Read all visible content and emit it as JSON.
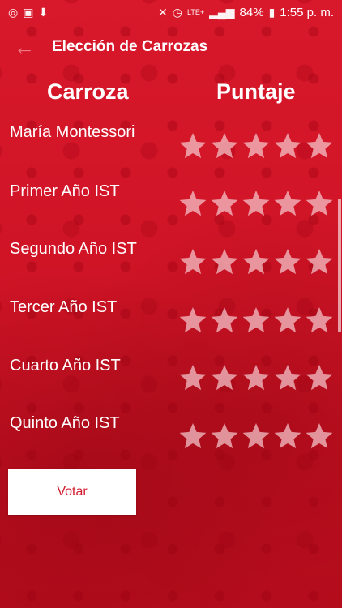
{
  "status_bar": {
    "battery": "84%",
    "time": "1:55 p. m.",
    "network": "LTE+",
    "icons": [
      "whatsapp-icon",
      "image-icon",
      "download-icon",
      "mute-icon",
      "alarm-icon",
      "signal-icon",
      "battery-icon"
    ]
  },
  "app_bar": {
    "title": "Elección de Carrozas",
    "back_icon": "arrow-left-icon"
  },
  "table": {
    "col_left": "Carroza",
    "col_right": "Puntaje",
    "rows": [
      {
        "name": "María Montessori",
        "rating": 0,
        "max": 5
      },
      {
        "name": "Primer Año IST",
        "rating": 0,
        "max": 5
      },
      {
        "name": "Segundo Año IST",
        "rating": 0,
        "max": 5
      },
      {
        "name": "Tercer Año IST",
        "rating": 0,
        "max": 5
      },
      {
        "name": "Cuarto Año IST",
        "rating": 0,
        "max": 5
      },
      {
        "name": "Quinto Año IST",
        "rating": 0,
        "max": 5
      }
    ]
  },
  "vote_button": {
    "label": "Votar"
  },
  "colors": {
    "background": "#cf1426",
    "button_text": "#d21a2e",
    "star_empty": "#f5c8cd"
  }
}
